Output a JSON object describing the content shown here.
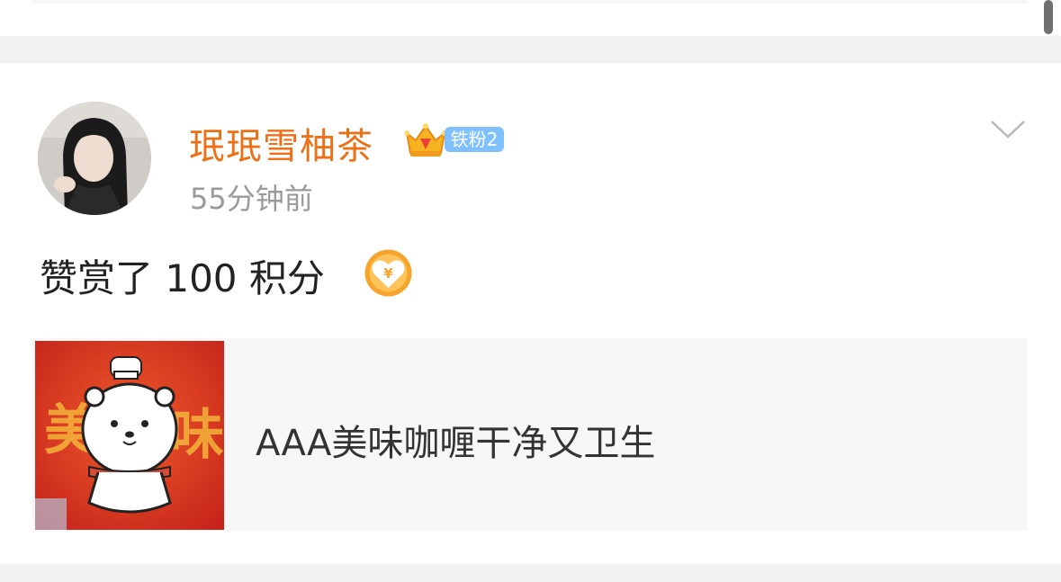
{
  "post": {
    "username": "珉珉雪柚茶",
    "badge_label": "铁粉2",
    "time": "55分钟前",
    "text": "赞赏了 100 积分",
    "link_card": {
      "title": "AAA美味咖喱干净又卫生",
      "thumb_text_left": "美",
      "thumb_text_right": "味"
    }
  },
  "icons": {
    "avatar": "user-avatar",
    "crown": "crown-icon",
    "more": "chevron-down-icon",
    "reward": "yuan-heart-icon"
  },
  "colors": {
    "username": "#ed7016",
    "badge": "#7fc0ff",
    "time": "#9a9a9a",
    "reward": "#f5a623",
    "thumb_bg": "#d8321d"
  }
}
